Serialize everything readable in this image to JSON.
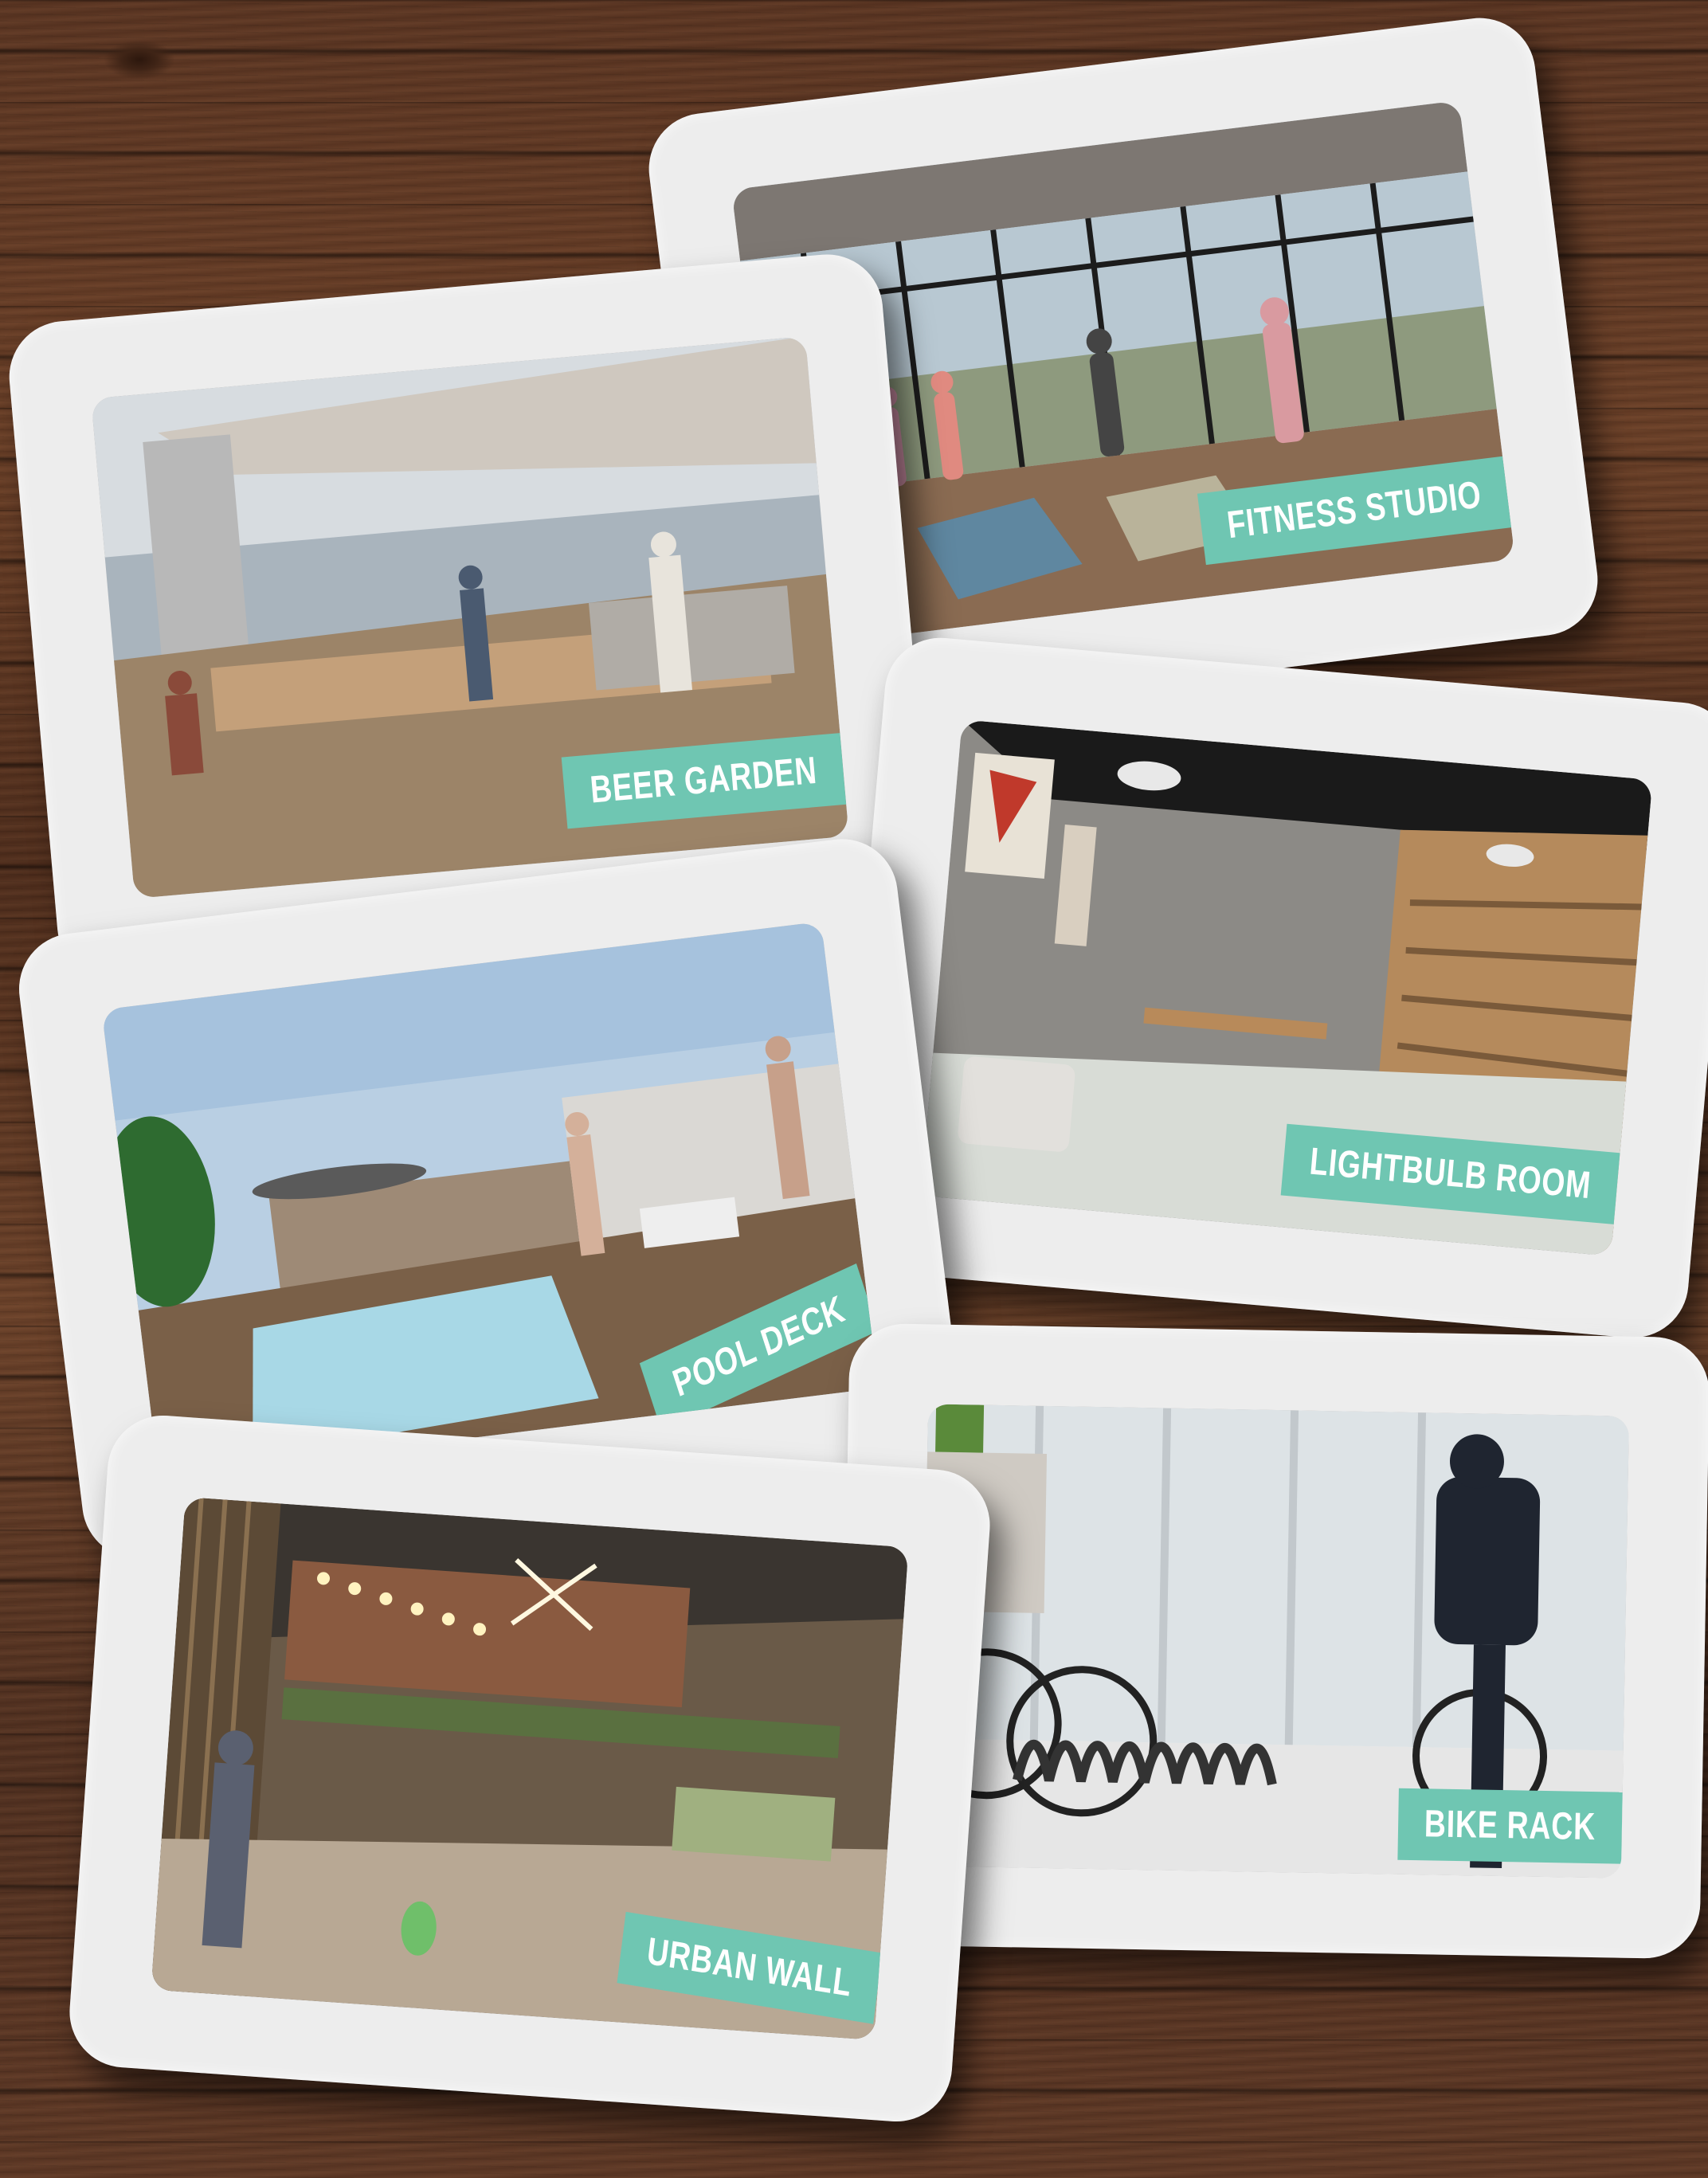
{
  "cards": [
    {
      "label": "FITNESS STUDIO"
    },
    {
      "label": "BEER GARDEN"
    },
    {
      "label": "LIGHTBULB ROOM"
    },
    {
      "label": "POOL DECK"
    },
    {
      "label": "BIKE RACK"
    },
    {
      "label": "URBAN WALL"
    }
  ],
  "colors": {
    "label_bg": "#6fc6b2",
    "frame": "#ededed",
    "wood": "#5b3522"
  }
}
